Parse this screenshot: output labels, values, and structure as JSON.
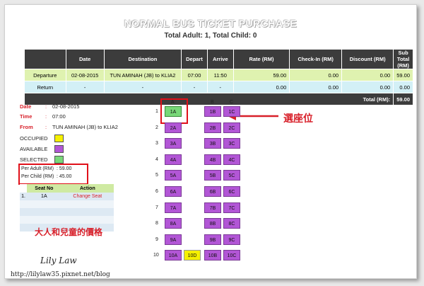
{
  "header": {
    "title": "NORMAL BUS TICKET PURCHASE",
    "subtitle": "Total Adult: 1, Total Child: 0"
  },
  "summary": {
    "columns": [
      "",
      "Date",
      "Destination",
      "Depart",
      "Arrive",
      "Rate (RM)",
      "Check-In (RM)",
      "Discount (RM)",
      "Sub Total (RM)"
    ],
    "departure": [
      "Departure",
      "02-08-2015",
      "TUN AMINAH (JB) to KLIA2",
      "07:00",
      "11:50",
      "59.00",
      "0.00",
      "0.00",
      "59.00"
    ],
    "return": [
      "Return",
      "-",
      "-",
      "-",
      "-",
      "0.00",
      "0.00",
      "0.00",
      "0.00"
    ],
    "total_label": "Total (RM):",
    "total_value": "59.00"
  },
  "info": {
    "date_label": "Date",
    "date_value": "02-08-2015",
    "time_label": "Time",
    "time_value": "07:00",
    "from_label": "From",
    "from_value": "TUN AMINAH (JB) to KLIA2",
    "colon": ":"
  },
  "legend": {
    "occupied": "OCCUPIED",
    "available": "AVAILABLE",
    "selected": "SELECTED"
  },
  "rates": {
    "adult_label": "Per Adult (RM)",
    "adult_value": ": 59.00",
    "child_label": "Per Child (RM)",
    "child_value": ": 45.00"
  },
  "actions": {
    "headers": [
      "Seat No",
      "Action"
    ],
    "row": {
      "index": "1.",
      "seat": "1A",
      "action": "Change Seat"
    }
  },
  "seatmap": {
    "col_headers": [
      "A",
      "B",
      "C"
    ],
    "rows": [
      {
        "num": "1",
        "seats": [
          "1A",
          "1B",
          "1C"
        ]
      },
      {
        "num": "2",
        "seats": [
          "2A",
          "2B",
          "2C"
        ]
      },
      {
        "num": "3",
        "seats": [
          "3A",
          "3B",
          "3C"
        ]
      },
      {
        "num": "4",
        "seats": [
          "4A",
          "4B",
          "4C"
        ]
      },
      {
        "num": "5",
        "seats": [
          "5A",
          "5B",
          "5C"
        ]
      },
      {
        "num": "6",
        "seats": [
          "6A",
          "6B",
          "6C"
        ]
      },
      {
        "num": "7",
        "seats": [
          "7A",
          "7B",
          "7C"
        ]
      },
      {
        "num": "8",
        "seats": [
          "8A",
          "8B",
          "8C"
        ]
      },
      {
        "num": "9",
        "seats": [
          "9A",
          "9B",
          "9C"
        ]
      },
      {
        "num": "10",
        "seats": [
          "10A",
          "10D",
          "10B",
          "10C"
        ]
      }
    ]
  },
  "annotations": {
    "select_seat": "選座位",
    "prices": "大人和兒童的價格"
  },
  "watermark": {
    "signature": "Lily Law",
    "url": "http://lilylaw35.pixnet.net/blog"
  },
  "colors": {
    "selected": "#78d878",
    "available": "#b256d6",
    "occupied": "#f5f000",
    "accent_red": "#d8202a",
    "header_dark": "#3c3c3c"
  }
}
